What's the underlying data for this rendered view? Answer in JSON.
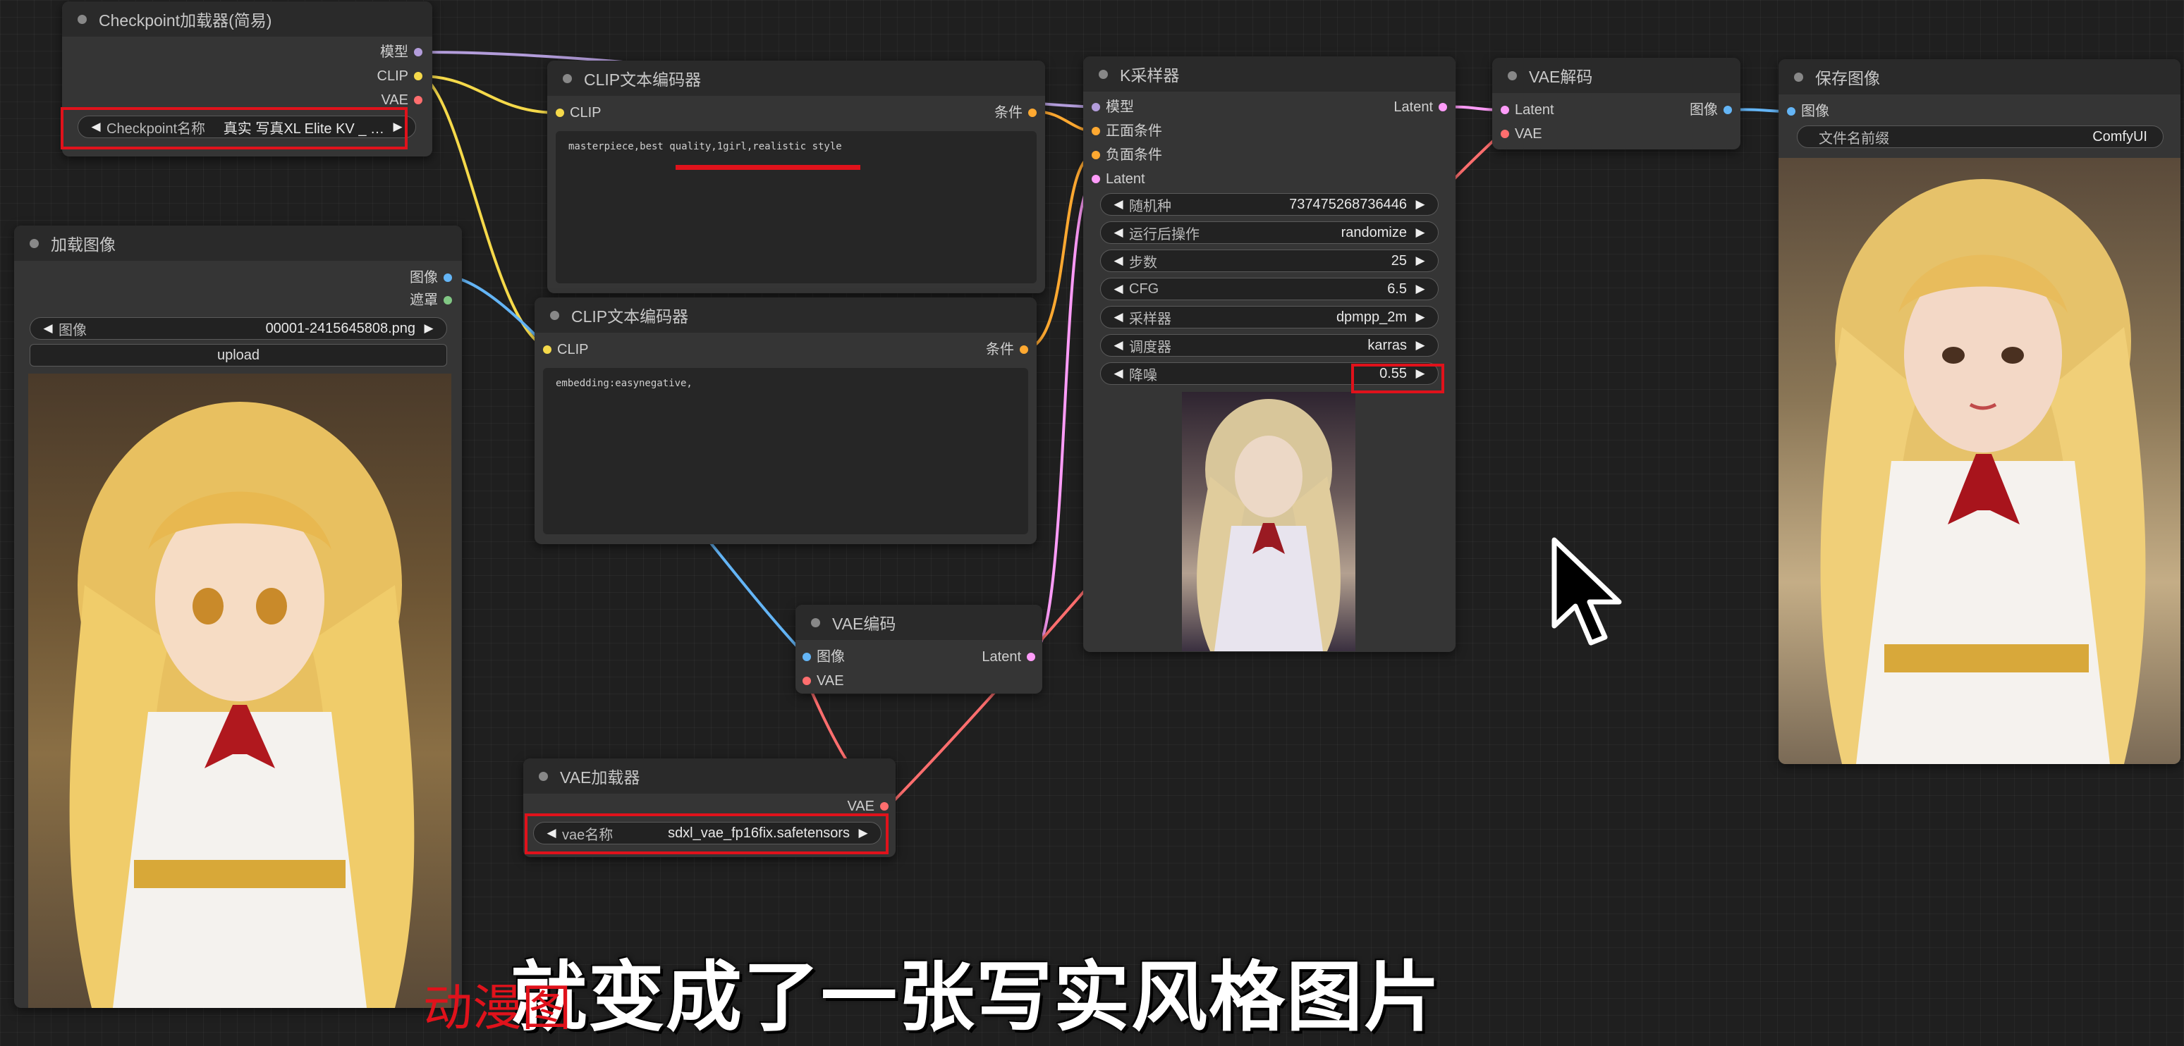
{
  "colors": {
    "model": "#b39ddb",
    "clip": "#f5d94a",
    "vae": "#ff6e6e",
    "conditioning": "#ffa931",
    "latent": "#ff9cf9",
    "image": "#64b5f6",
    "mask": "#81c784",
    "highlight": "#e0121b"
  },
  "checkpoint": {
    "title": "Checkpoint加载器(简易)",
    "out_model": "模型",
    "out_clip": "CLIP",
    "out_vae": "VAE",
    "widget_label": "Checkpoint名称",
    "widget_value": "真实 写真XL Elite KV _ …"
  },
  "load_image": {
    "title": "加载图像",
    "out_image": "图像",
    "out_mask": "遮罩",
    "widget_label": "图像",
    "widget_value": "00001-2415645808.png",
    "upload_label": "upload"
  },
  "clip_pos": {
    "title": "CLIP文本编码器",
    "in_clip": "CLIP",
    "out_cond": "条件",
    "text": "masterpiece,best quality,1girl,realistic style"
  },
  "clip_neg": {
    "title": "CLIP文本编码器",
    "in_clip": "CLIP",
    "out_cond": "条件",
    "text": "embedding:easynegative,"
  },
  "ksampler": {
    "title": "K采样器",
    "in_model": "模型",
    "in_pos": "正面条件",
    "in_neg": "负面条件",
    "in_latent": "Latent",
    "out_latent": "Latent",
    "widgets": [
      {
        "label": "随机种",
        "value": "737475268736446"
      },
      {
        "label": "运行后操作",
        "value": "randomize"
      },
      {
        "label": "步数",
        "value": "25"
      },
      {
        "label": "CFG",
        "value": "6.5"
      },
      {
        "label": "采样器",
        "value": "dpmpp_2m"
      },
      {
        "label": "调度器",
        "value": "karras"
      },
      {
        "label": "降噪",
        "value": "0.55"
      }
    ]
  },
  "vae_decode": {
    "title": "VAE解码",
    "in_latent": "Latent",
    "in_vae": "VAE",
    "out_image": "图像"
  },
  "save_image": {
    "title": "保存图像",
    "in_image": "图像",
    "widget_label": "文件名前缀",
    "widget_value": "ComfyUI"
  },
  "vae_encode": {
    "title": "VAE编码",
    "in_image": "图像",
    "in_vae": "VAE",
    "out_latent": "Latent"
  },
  "vae_loader": {
    "title": "VAE加载器",
    "out_vae": "VAE",
    "widget_label": "vae名称",
    "widget_value": "sdxl_vae_fp16fix.safetensors"
  },
  "subtitle": {
    "main": "就变成了一张写实风格图片",
    "overlay": "动漫图"
  }
}
